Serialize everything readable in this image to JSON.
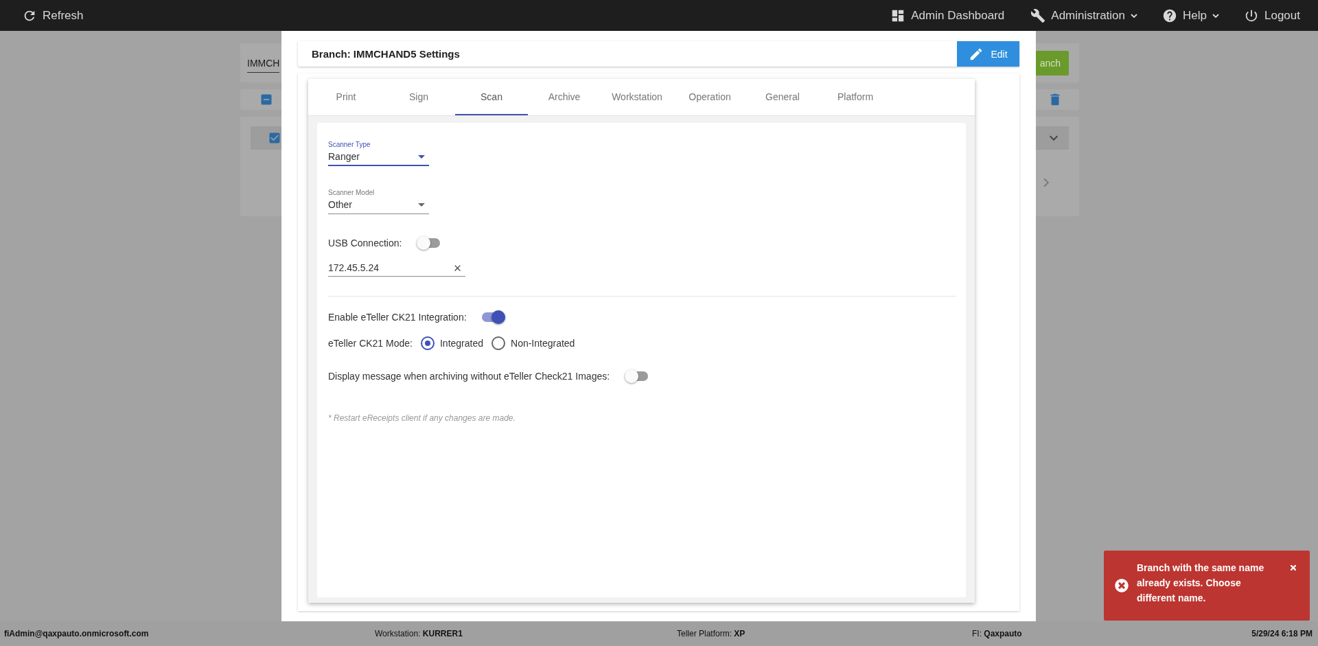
{
  "top_bar": {
    "left": [
      {
        "label": "Refresh",
        "dropdown": false
      }
    ],
    "right": [
      {
        "label": "Admin Dashboard",
        "dropdown": false
      },
      {
        "label": "Administration",
        "dropdown": true
      },
      {
        "label": "Help",
        "dropdown": true
      },
      {
        "label": "Logout",
        "dropdown": false
      }
    ]
  },
  "background": {
    "search_value": "IMMCH",
    "button_label": "anch",
    "bulk_checkbox_indeterminate": true,
    "row_checked": true
  },
  "modal": {
    "title": "Branch: IMMCHAND5 Settings",
    "edit_button": "Edit",
    "tabs": [
      {
        "label": "Print",
        "selected": false
      },
      {
        "label": "Sign",
        "selected": false
      },
      {
        "label": "Scan",
        "selected": true
      },
      {
        "label": "Archive",
        "selected": false
      },
      {
        "label": "Workstation",
        "selected": false
      },
      {
        "label": "Operation",
        "selected": false
      },
      {
        "label": "General",
        "selected": false
      },
      {
        "label": "Platform",
        "selected": false
      }
    ],
    "fields": [
      {
        "kind": "select",
        "label": "Scanner Type",
        "value": "Ranger",
        "focused": true
      },
      {
        "kind": "select",
        "label": "Scanner Model",
        "value": "Other",
        "focused": false
      },
      {
        "kind": "toggle",
        "label": "USB Connection:",
        "on": false
      },
      {
        "kind": "text",
        "value": "172.45.5.24"
      },
      {
        "kind": "divider"
      },
      {
        "kind": "toggle",
        "label": "Enable eTeller CK21 Integration:",
        "on": true
      },
      {
        "kind": "radio",
        "label": "eTeller CK21 Mode:",
        "options": [
          {
            "label": "Integrated",
            "selected": true
          },
          {
            "label": "Non-Integrated",
            "selected": false
          }
        ]
      },
      {
        "kind": "toggle",
        "label": "Display message when archiving without eTeller Check21 Images:",
        "on": false
      },
      {
        "kind": "note",
        "text": "* Restart eReceipts client if any changes are made."
      }
    ]
  },
  "toast": {
    "message": "Branch with the same name already exists. Choose different name."
  },
  "status_bar": {
    "user": "fiAdmin@qaxpauto.onmicrosoft.com",
    "workstation": "Workstation: **KURRER1**",
    "platform": "Teller Platform: **XP**",
    "fi": "FI: **Qaxpauto**",
    "datetime": "5/29/24 6:18 PM"
  }
}
